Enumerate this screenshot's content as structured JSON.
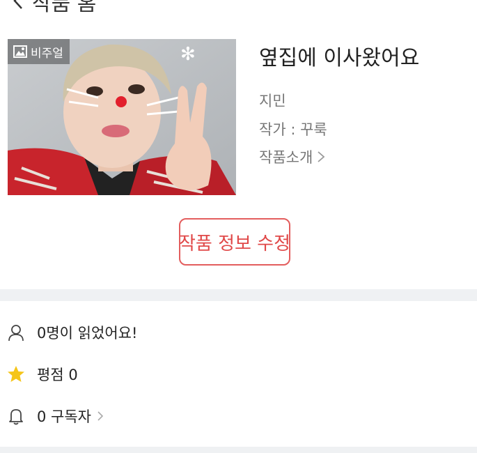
{
  "header": {
    "title": "작품 홈",
    "back_icon": "chevron-left-icon"
  },
  "work": {
    "badge_label": "비주얼",
    "badge_icon": "image-icon",
    "title": "옆집에 이사왔어요",
    "author": "지민",
    "writer": "작가 : 꾸룩",
    "intro_label": "작품소개"
  },
  "edit_button_label": "작품 정보 수정",
  "stats": {
    "readers": "0명이 읽었어요!",
    "rating": "평점 0",
    "subscribers": "0 구독자"
  },
  "colors": {
    "accent_red": "#e04848",
    "divider": "#eff1f3",
    "star": "#f5c518"
  }
}
